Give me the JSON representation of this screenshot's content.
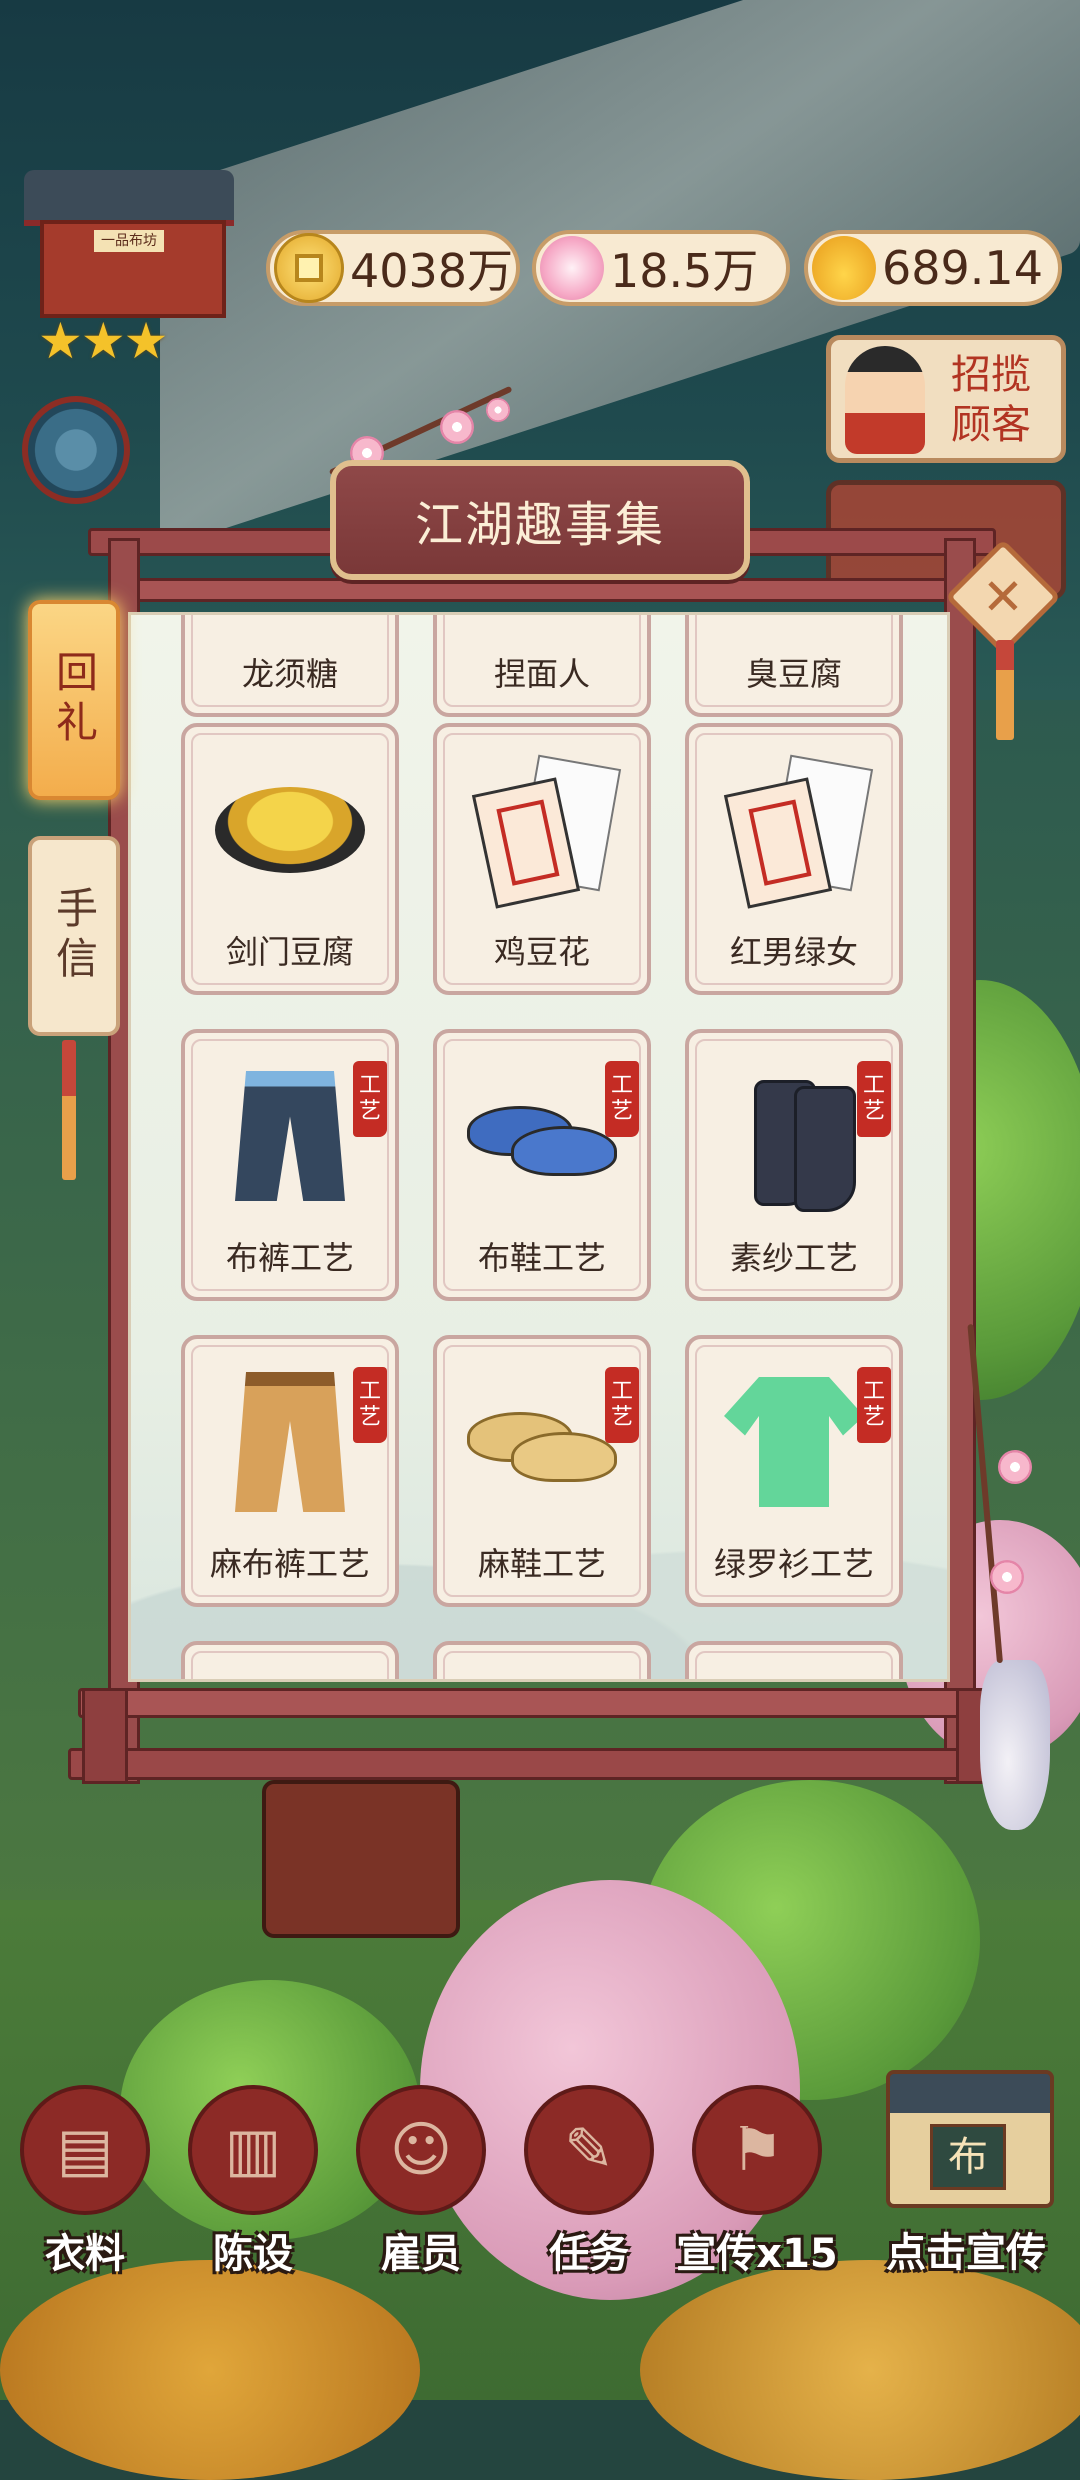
{
  "currency": {
    "coins": "4038万",
    "flowers": "18.5万",
    "gold": "689.14"
  },
  "shop": {
    "sign": "一品布坊",
    "stars": "★★★"
  },
  "recruit": {
    "label": "招揽顾客"
  },
  "panel": {
    "title": "江湖趣事集",
    "close_glyph": "✕"
  },
  "tabs": [
    {
      "label": "回礼",
      "active": true
    },
    {
      "label": "手信",
      "active": false
    }
  ],
  "items": [
    {
      "name": "龙须糖",
      "icon": "dragon-beard-candy-icon",
      "craft": false
    },
    {
      "name": "捏面人",
      "icon": "dough-figurine-icon",
      "craft": false
    },
    {
      "name": "臭豆腐",
      "icon": "stinky-tofu-icon",
      "craft": false
    },
    {
      "name": "剑门豆腐",
      "icon": "tofu-bowl-icon",
      "craft": false
    },
    {
      "name": "鸡豆花",
      "icon": "letter-icon",
      "craft": false
    },
    {
      "name": "红男绿女",
      "icon": "letter-icon",
      "craft": false
    },
    {
      "name": "布裤工艺",
      "icon": "cloth-pants-icon",
      "craft": true
    },
    {
      "name": "布鞋工艺",
      "icon": "cloth-shoes-icon",
      "craft": true
    },
    {
      "name": "素纱工艺",
      "icon": "boots-icon",
      "craft": true
    },
    {
      "name": "麻布裤工艺",
      "icon": "linen-pants-icon",
      "craft": true
    },
    {
      "name": "麻鞋工艺",
      "icon": "straw-shoes-icon",
      "craft": true
    },
    {
      "name": "绿罗衫工艺",
      "icon": "green-robe-icon",
      "craft": true
    }
  ],
  "craft_tag": "工艺",
  "bottom_nav": [
    {
      "label": "衣料",
      "icon": "fabric-icon"
    },
    {
      "label": "陈设",
      "icon": "cabinet-icon"
    },
    {
      "label": "雇员",
      "icon": "employee-icon"
    },
    {
      "label": "任务",
      "icon": "scroll-icon"
    },
    {
      "label": "宣传x15",
      "icon": "banner-icon"
    }
  ],
  "promote": {
    "label": "点击宣传",
    "sign": "布"
  }
}
